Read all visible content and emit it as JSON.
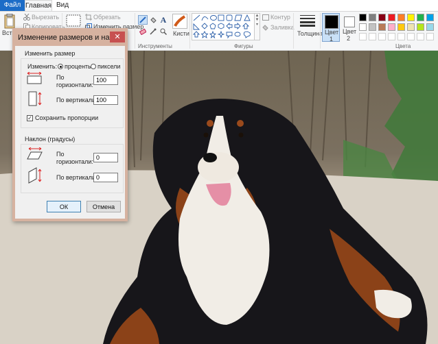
{
  "tabs": {
    "file": "Файл",
    "home": "Главная",
    "view": "Вид"
  },
  "clipboard": {
    "paste": "Вставить",
    "cut": "Вырезать",
    "copy": "Копировать"
  },
  "image": {
    "crop": "Обрезать",
    "resize": "Изменить размер"
  },
  "groups": {
    "tools": "Инструменты",
    "shapes": "Фигуры",
    "colors": "Цвета"
  },
  "tools": {
    "brushes": "Кисти"
  },
  "shapes_group": {
    "outline": "Контур",
    "fill": "Заливка"
  },
  "size": {
    "label": "Толщина"
  },
  "color1": {
    "line1": "Цвет",
    "line2": "1",
    "color": "#000000"
  },
  "color2": {
    "line1": "Цвет",
    "line2": "2",
    "color": "#ffffff"
  },
  "palette_colors": [
    "#000000",
    "#7f7f7f",
    "#880015",
    "#ed1c24",
    "#ff7f27",
    "#fff200",
    "#22b14c",
    "#00a2e8",
    "#ffffff",
    "#c3c3c3",
    "#b97a57",
    "#ffaec9",
    "#ffc90e",
    "#efe4b0",
    "#b5e61d",
    "#99d9ea"
  ],
  "dialog": {
    "title": "Изменение размеров и накл...",
    "close": "✕",
    "resize_section": "Изменить размер",
    "by_label": "Изменить:",
    "percent_option": "проценты",
    "pixels_option": "пиксели",
    "horizontal_line1": "По",
    "horizontal_line2": "горизонтали:",
    "vertical_label": "По вертикали:",
    "horizontal_value": "100",
    "vertical_value": "100",
    "keep_ratio": "Сохранить пропорции",
    "skew_section": "Наклон (градусы)",
    "skew_horizontal_line1": "По",
    "skew_horizontal_line2": "горизонтали:",
    "skew_vertical_label": "По вертикали:",
    "skew_horizontal_value": "0",
    "skew_vertical_value": "0",
    "ok": "ОК",
    "cancel": "Отмена"
  }
}
